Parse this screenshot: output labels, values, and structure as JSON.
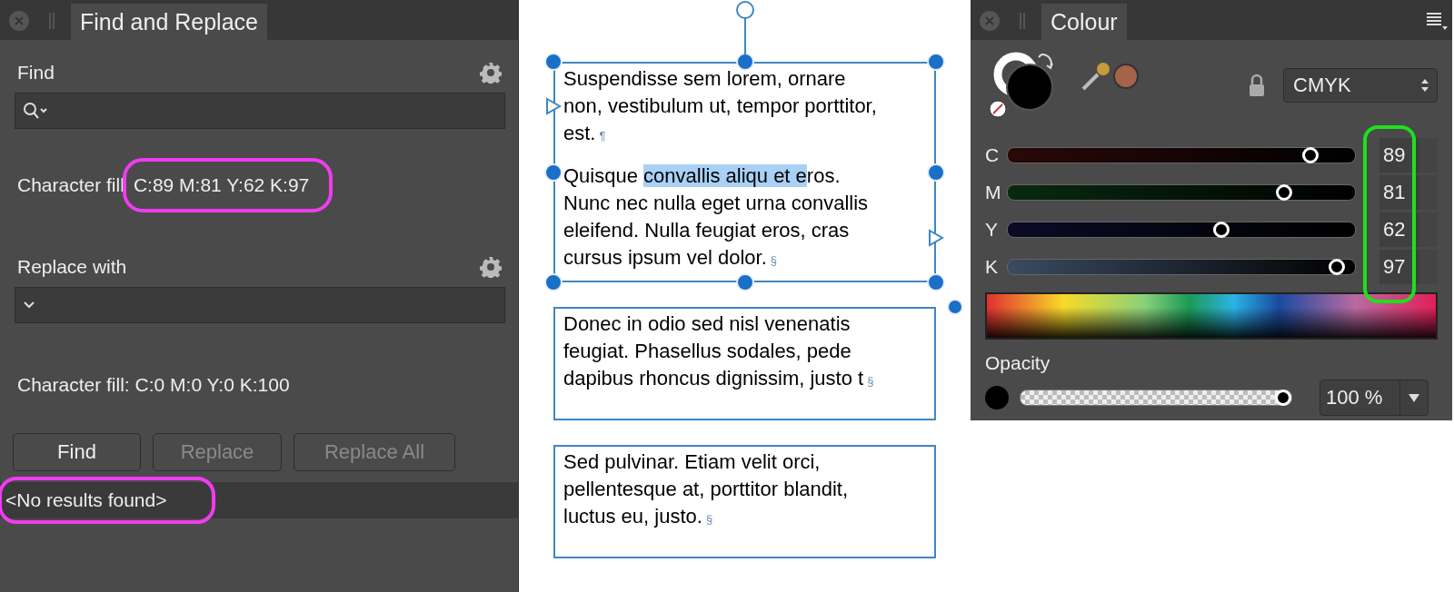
{
  "find_replace": {
    "tab": {
      "title": "Find and Replace",
      "selected": true
    },
    "find": {
      "label": "Find"
    },
    "find_format": {
      "label": "Character fill",
      "value": "C:89 M:81 Y:62 K:97",
      "circled": true
    },
    "replace": {
      "label": "Replace with"
    },
    "replace_format": {
      "text": "Character fill: C:0 M:0 Y:0 K:100"
    },
    "buttons": [
      {
        "label": "Find",
        "disabled": false
      },
      {
        "label": "Replace",
        "disabled": true
      },
      {
        "label": "Replace All",
        "disabled": true
      }
    ],
    "results": {
      "text": "<No results found>",
      "circled": true
    }
  },
  "canvas": {
    "frames": [
      {
        "selected": true,
        "paragraphs": [
          {
            "mark": "¶",
            "lines": [
              [
                {
                  "text": "Suspendisse sem lorem, ornare",
                  "selected": false
                }
              ],
              [
                {
                  "text": "non, vestibulum ut, tempor porttitor,",
                  "selected": false
                }
              ],
              [
                {
                  "text": "est.",
                  "selected": false
                }
              ]
            ]
          },
          {
            "mark": "§",
            "lines": [
              [
                {
                  "text": "Quisque ",
                  "selected": false
                },
                {
                  "text": "convallis aliqu et e",
                  "selected": true
                },
                {
                  "text": "ros.",
                  "selected": false
                }
              ],
              [
                {
                  "text": "Nunc nec nulla eget urna convallis",
                  "selected": false
                }
              ],
              [
                {
                  "text": "eleifend. Nulla feugiat eros, cras",
                  "selected": false
                }
              ],
              [
                {
                  "text": "cursus ipsum vel dolor.",
                  "selected": false
                }
              ]
            ]
          }
        ]
      },
      {
        "selected": false,
        "paragraphs": [
          {
            "mark": "§",
            "lines": [
              [
                {
                  "text": "Donec in odio sed nisl venenatis",
                  "selected": false
                }
              ],
              [
                {
                  "text": "feugiat. Phasellus sodales, pede",
                  "selected": false
                }
              ],
              [
                {
                  "text": "dapibus rhoncus dignissim, justo t",
                  "selected": false
                }
              ]
            ]
          }
        ]
      },
      {
        "selected": false,
        "paragraphs": [
          {
            "mark": "§",
            "lines": [
              [
                {
                  "text": "Sed pulvinar. Etiam velit orci,",
                  "selected": false
                }
              ],
              [
                {
                  "text": "pellentesque at, porttitor blandit,",
                  "selected": false
                }
              ],
              [
                {
                  "text": "luctus eu, justo.",
                  "selected": false
                }
              ]
            ]
          }
        ]
      }
    ]
  },
  "colour": {
    "tab": {
      "title": "Colour",
      "selected": true
    },
    "model": "CMYK",
    "values_circled": true,
    "channels": [
      {
        "name": "C",
        "level": 0.89,
        "value": "89"
      },
      {
        "name": "M",
        "level": 0.81,
        "value": "81"
      },
      {
        "name": "Y",
        "level": 0.62,
        "value": "62"
      },
      {
        "name": "K",
        "level": 0.97,
        "value": "97"
      }
    ],
    "opacity": {
      "label": "Opacity",
      "level": 1,
      "reading": "100 %"
    }
  }
}
